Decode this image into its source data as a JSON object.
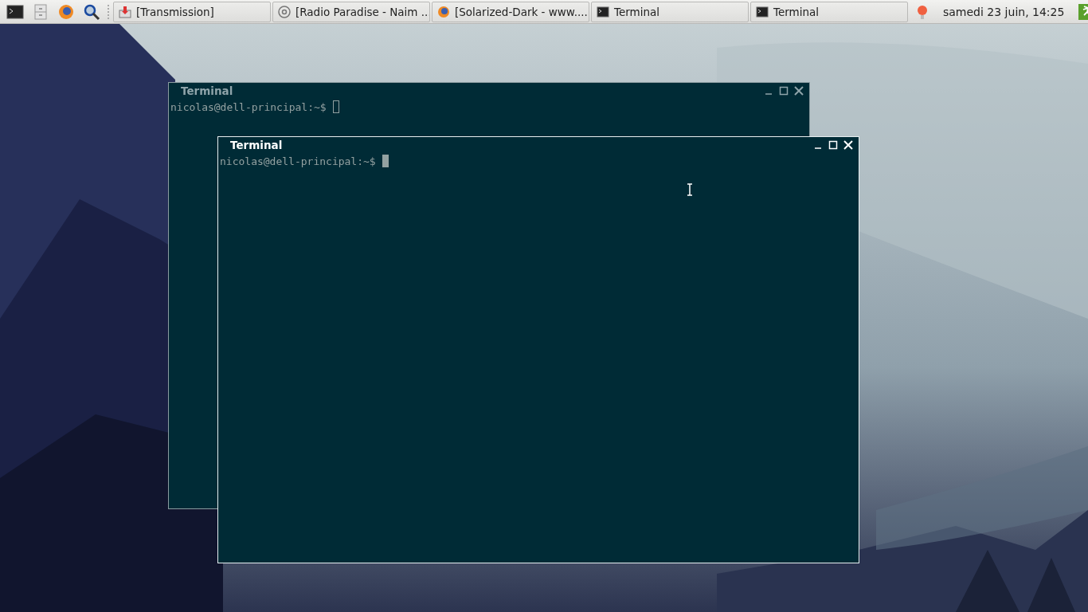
{
  "taskbar": {
    "tasks": [
      {
        "kind": "download",
        "label": "[Transmission]"
      },
      {
        "kind": "radio",
        "label": "[Radio Paradise - Naim ..."
      },
      {
        "kind": "browser",
        "label": "[Solarized-Dark - www...."
      },
      {
        "kind": "terminal",
        "label": "Terminal"
      },
      {
        "kind": "terminal",
        "label": "Terminal"
      }
    ],
    "clock": "samedi 23 juin, 14:25"
  },
  "windows": [
    {
      "title": "Terminal",
      "prompt": "nicolas@dell-principal:~$",
      "focused": false
    },
    {
      "title": "Terminal",
      "prompt": "nicolas@dell-principal:~$",
      "focused": true
    }
  ]
}
